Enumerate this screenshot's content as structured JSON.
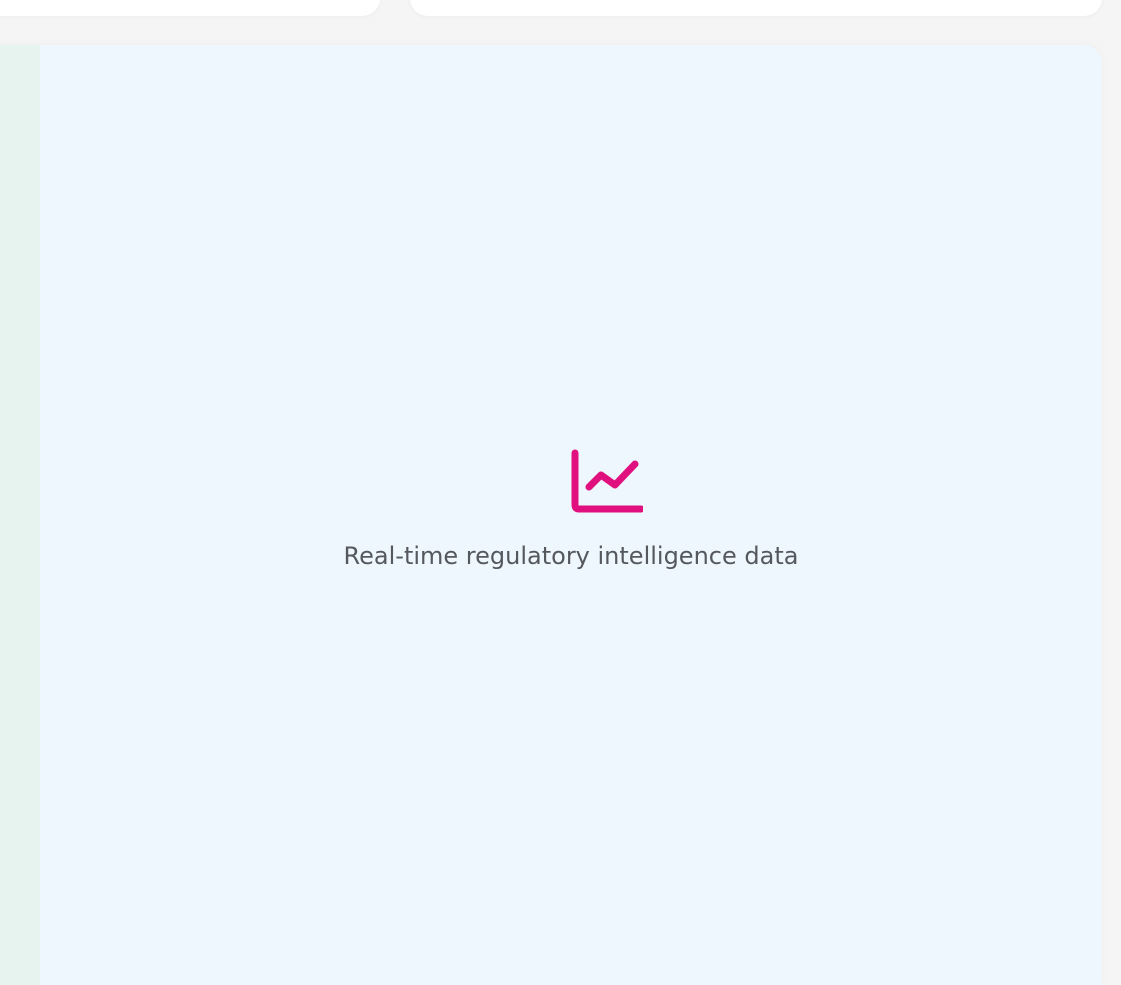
{
  "placeholder": {
    "message": "Real-time regulatory intelligence data",
    "icon": "line-chart-icon",
    "accent_color": "#e0117f"
  },
  "colors": {
    "page_background": "#f5f5f5",
    "panel_background": "#eef6fe",
    "strip_background": "#e6f3ee",
    "card_background": "#ffffff",
    "text": "#55595e"
  }
}
